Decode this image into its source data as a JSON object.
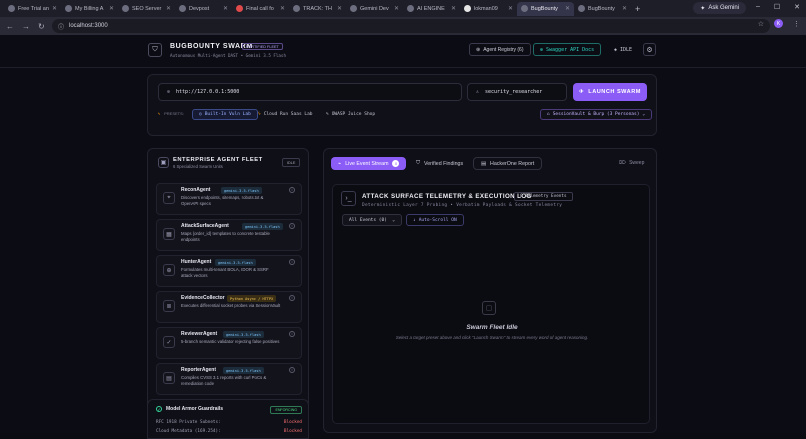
{
  "browser": {
    "tabs": [
      {
        "title": "Free Trial an"
      },
      {
        "title": "My Billing A"
      },
      {
        "title": "SEO Server"
      },
      {
        "title": "Devpost"
      },
      {
        "title": "Final call fo"
      },
      {
        "title": "TRACK: TH"
      },
      {
        "title": "Gemini Dev"
      },
      {
        "title": "AI ENGINE"
      },
      {
        "title": "lokman09"
      },
      {
        "title": "BugBounty"
      },
      {
        "title": "BugBounty"
      }
    ],
    "ask_gemini": "Ask Gemini",
    "url": "localhost:3000",
    "avatar_letter": "K"
  },
  "header": {
    "brand": "BUGBOUNTY SWARM",
    "brand_badge": "FORTIFIED FLEET",
    "brand_sub": "Autonomous Multi-Agent DAST • Gemini 3.5 Flash",
    "agent_registry": "Agent Registry (6)",
    "swagger": "Swagger API Docs",
    "status": "IDLE"
  },
  "launch": {
    "target_url": "http://127.0.0.1:5000",
    "role": "security_researcher",
    "launch_label": "LAUNCH SWARM",
    "presets_label": "PRESETS:",
    "presets": [
      "Built-In Vuln Lab",
      "Cloud Run Saas Lab",
      "OWASP Juice Shop"
    ],
    "profile": "SessionVault & Burp (3 Personas)"
  },
  "fleet": {
    "title": "ENTERPRISE AGENT FLEET",
    "subtitle": "6 Specialized Swarm Units",
    "status": "IDLE",
    "agents": [
      {
        "name": "ReconAgent",
        "model": "gemini-3.5-flash",
        "model_kind": "g",
        "desc": "Discovers endpoints, sitemaps, robots.txt & OpenAPI specs"
      },
      {
        "name": "AttackSurfaceAgent",
        "model": "gemini-3.5-flash",
        "model_kind": "g",
        "desc": "Maps {order_id} templates to concrete testable endpoints"
      },
      {
        "name": "HunterAgent",
        "model": "gemini-3.5-flash",
        "model_kind": "g",
        "desc": "Formulates multi-tenant BOLA, IDOR & SSRF attack vectors"
      },
      {
        "name": "EvidenceCollector",
        "model": "Python Async / HTTPX",
        "model_kind": "p",
        "desc": "Executes differential socket probes via SessionVault"
      },
      {
        "name": "ReviewerAgent",
        "model": "gemini-3.5-flash",
        "model_kind": "g",
        "desc": "5-branch semantic validator rejecting false positives"
      },
      {
        "name": "ReporterAgent",
        "model": "gemini-3.5-flash",
        "model_kind": "g",
        "desc": "Compiles CVSS 3.1 reports with curl PoCs & remediation code"
      }
    ]
  },
  "guardrails": {
    "title": "Model Armor Guardrails",
    "badge": "ENFORCING",
    "rows": [
      {
        "label": "RFC 1918 Private Subnets:",
        "value": "Blocked"
      },
      {
        "label": "Cloud Metadata (169.254):",
        "value": "Blocked"
      }
    ]
  },
  "stream": {
    "tabs": [
      {
        "label": "Live Event Stream",
        "count": "0"
      },
      {
        "label": "Verified Findings"
      },
      {
        "label": "HackerOne Report"
      }
    ],
    "sweep_label": "Sweep",
    "telemetry_title": "ATTACK SURFACE TELEMETRY & EXECUTION LOG",
    "telemetry_badge": "0 Telemetry Events",
    "telemetry_sub": "Deterministic Layer 7 Probing • Verbatim Payloads & Socket Telemetry",
    "filter": "All Events (0)",
    "autoscroll": "Auto-Scroll ON",
    "empty_title": "Swarm Fleet Idle",
    "empty_sub": "Select a target preset above and click \"Launch Swarm\" to stream every word of agent reasoning."
  },
  "colors": {
    "accent": "#8b5cf6",
    "teal": "#2dd4bf",
    "blocked": "#f87171",
    "enforcing": "#4ade80"
  }
}
